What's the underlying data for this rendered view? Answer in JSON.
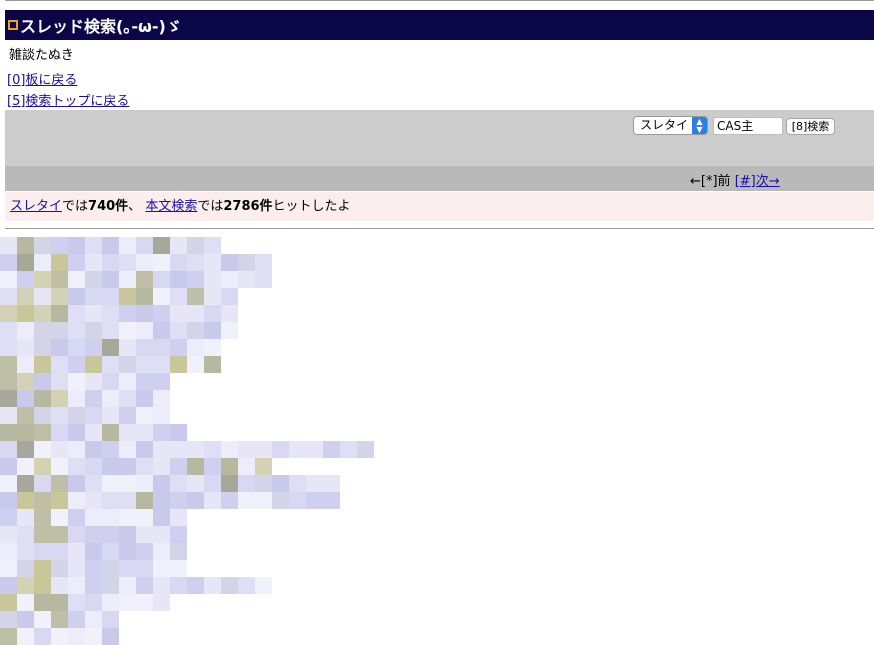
{
  "title": "スレッド検索(｡-ω-)ゞ",
  "board_name": "雑談たぬき",
  "nav": {
    "back_to_board": "[0]板に戻る",
    "back_to_search_top": "[5]検索トップに戻る"
  },
  "search": {
    "select_value": "スレタイ",
    "query": "CAS主",
    "button_label": "[8]検索"
  },
  "pager": {
    "prev": "←[*]前",
    "next": "[#]次→"
  },
  "results": {
    "title_link": "スレタイ",
    "title_suffix": "では",
    "title_count": "740件",
    "sep": "、",
    "body_link": "本文検索",
    "body_suffix": "では",
    "body_count": "2786件",
    "tail": "ヒットしたよ"
  },
  "colors": {
    "title_bar": "#0b0648",
    "search_bar": "#cccccc",
    "pager_bar": "#b9b9b9",
    "result_bar": "#fdeeee",
    "link": "#1a0dab"
  }
}
